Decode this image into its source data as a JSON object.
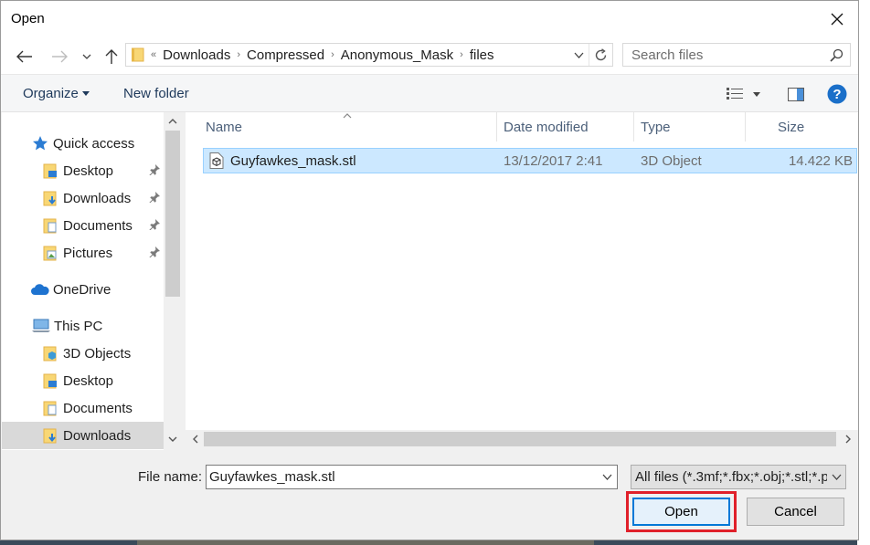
{
  "window": {
    "title": "Open"
  },
  "toolbar": {
    "back_icon": "arrow-left-icon",
    "forward_icon": "arrow-right-icon",
    "recent_icon": "chevron-down-icon",
    "up_icon": "arrow-up-icon"
  },
  "address": {
    "overflow": "«",
    "crumbs": [
      "Downloads",
      "Compressed",
      "Anonymous_Mask",
      "files"
    ]
  },
  "search": {
    "placeholder": "Search files"
  },
  "commands": {
    "organize": "Organize",
    "new_folder": "New folder"
  },
  "sidebar": {
    "items": [
      {
        "label": "Quick access",
        "icon": "star-icon",
        "pinned": false
      },
      {
        "label": "Desktop",
        "icon": "desktop-folder-icon",
        "pinned": true
      },
      {
        "label": "Downloads",
        "icon": "downloads-folder-icon",
        "pinned": true
      },
      {
        "label": "Documents",
        "icon": "documents-folder-icon",
        "pinned": true
      },
      {
        "label": "Pictures",
        "icon": "pictures-folder-icon",
        "pinned": true
      },
      {
        "label": "OneDrive",
        "icon": "cloud-icon",
        "pinned": false
      },
      {
        "label": "This PC",
        "icon": "computer-icon",
        "pinned": false
      },
      {
        "label": "3D Objects",
        "icon": "3d-objects-folder-icon",
        "pinned": false
      },
      {
        "label": "Desktop",
        "icon": "desktop-folder-icon",
        "pinned": false
      },
      {
        "label": "Documents",
        "icon": "documents-folder-icon",
        "pinned": false
      },
      {
        "label": "Downloads",
        "icon": "downloads-folder-icon",
        "pinned": false,
        "selected": true
      }
    ]
  },
  "files": {
    "columns": [
      "Name",
      "Date modified",
      "Type",
      "Size"
    ],
    "rows": [
      {
        "name": "Guyfawkes_mask.stl",
        "date": "13/12/2017 2:41",
        "type": "3D Object",
        "size": "14.422 KB"
      }
    ]
  },
  "footer": {
    "filename_label": "File name:",
    "filename_value": "Guyfawkes_mask.stl",
    "filetype": "All files (*.3mf;*.fbx;*.obj;*.stl;*.p",
    "open_label": "Open",
    "cancel_label": "Cancel"
  },
  "colors": {
    "accent": "#0078d7",
    "selection": "#cce8ff",
    "highlight": "#e0202a"
  }
}
